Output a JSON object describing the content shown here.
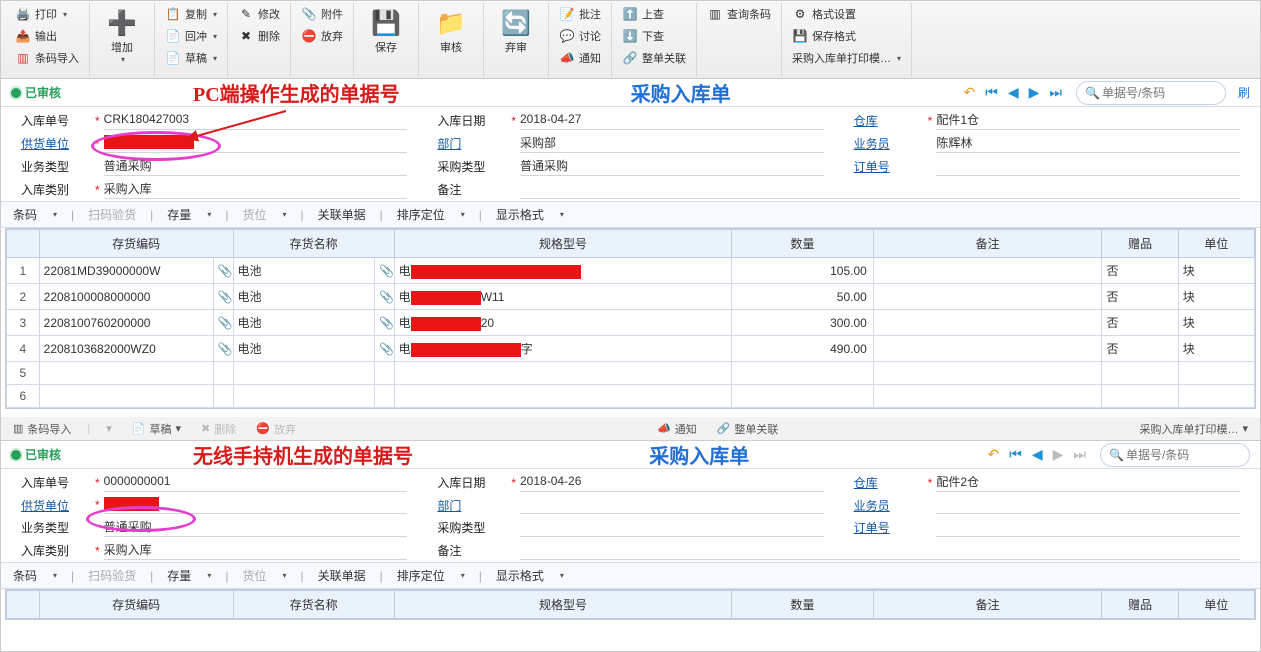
{
  "ribbon": {
    "print": "打印",
    "output": "输出",
    "bcimport": "条码导入",
    "add": "增加",
    "copy": "复制",
    "settle": "回冲",
    "draft": "草稿",
    "edit": "修改",
    "delete": "删除",
    "attach": "附件",
    "discard": "放弃",
    "save": "保存",
    "approve": "审核",
    "abandon": "弃审",
    "batchappr": "批注",
    "discuss": "讨论",
    "notify": "通知",
    "prev": "上查",
    "next": "下查",
    "closeall": "整单关联",
    "querybc": "查询条码",
    "format": "格式设置",
    "savefmt": "保存格式",
    "printtpl": "采购入库单打印模…"
  },
  "top": {
    "status": "已审核",
    "annot": "PC端操作生成的单据号",
    "doctitle": "采购入库单",
    "search_ph": "单据号/条码",
    "refresh": "刷",
    "undo": "↶",
    "first": "⏮",
    "prev": "◀",
    "next": "▶",
    "last": "⏭",
    "mag": "🔍"
  },
  "f1": {
    "billno_l": "入库单号",
    "billno": "CRK180427003",
    "supplier_l": "供货单位",
    "biztype_l": "业务类型",
    "biztype": "普通采购",
    "class_l": "入库类别",
    "class": "采购入库",
    "date_l": "入库日期",
    "date": "2018-04-27",
    "dept_l": "部门",
    "dept": "采购部",
    "ptype_l": "采购类型",
    "ptype": "普通采购",
    "remark_l": "备注",
    "wh_l": "仓库",
    "wh": "配件1仓",
    "clerk_l": "业务员",
    "clerk": "陈辉林",
    "order_l": "订单号"
  },
  "tb": {
    "barcode": "条码",
    "scan": "扫码验货",
    "stock": "存量",
    "slot": "货位",
    "link": "关联单据",
    "sort": "排序定位",
    "disp": "显示格式"
  },
  "gh": {
    "code": "存货编码",
    "name": "存货名称",
    "spec": "规格型号",
    "qty": "数量",
    "remark": "备注",
    "gift": "赠品",
    "unit": "单位"
  },
  "rows": [
    {
      "n": 1,
      "code": "22081MD39000000W",
      "name": "电池",
      "spec_pre": "电",
      "spec_red": 170,
      "spec_suf": "",
      "qty": "105.00",
      "gift": "否",
      "unit": "块"
    },
    {
      "n": 2,
      "code": "2208100008000000",
      "name": "电池",
      "spec_pre": "电",
      "spec_red": 70,
      "spec_suf": "W11",
      "qty": "50.00",
      "gift": "否",
      "unit": "块"
    },
    {
      "n": 3,
      "code": "2208100760200000",
      "name": "电池",
      "spec_pre": "电",
      "spec_red": 70,
      "spec_suf": "20",
      "qty": "300.00",
      "gift": "否",
      "unit": "块"
    },
    {
      "n": 4,
      "code": "2208103682000WZ0",
      "name": "电池",
      "spec_pre": "电",
      "spec_red": 110,
      "spec_suf": "字",
      "qty": "490.00",
      "gift": "否",
      "unit": "块"
    }
  ],
  "rib2": {
    "bcimport": "条码导入",
    "draft": "草稿",
    "delete": "删除",
    "discard": "放弃",
    "notify": "通知",
    "closeall": "整单关联",
    "printtpl": "采购入库单打印模…"
  },
  "bot": {
    "status": "已审核",
    "annot": "无线手持机生成的单据号",
    "doctitle": "采购入库单",
    "search_ph": "单据号/条码"
  },
  "f2": {
    "billno_l": "入库单号",
    "billno": "0000000001",
    "supplier_l": "供货单位",
    "biztype_l": "业务类型",
    "biztype": "普通采购",
    "class_l": "入库类别",
    "class": "采购入库",
    "date_l": "入库日期",
    "date": "2018-04-26",
    "dept_l": "部门",
    "ptype_l": "采购类型",
    "remark_l": "备注",
    "wh_l": "仓库",
    "wh": "配件2仓",
    "clerk_l": "业务员",
    "order_l": "订单号"
  }
}
